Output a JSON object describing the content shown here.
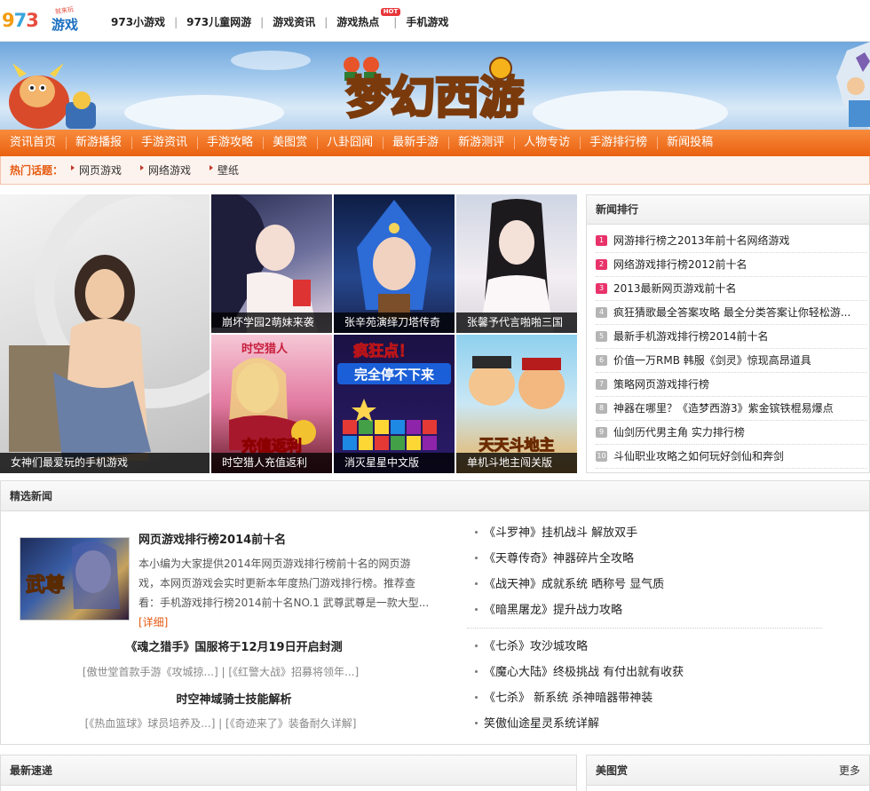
{
  "logo": {
    "digits": [
      "9",
      "7",
      "3"
    ],
    "name": "游戏",
    "slogan": "就来玩"
  },
  "topnav": {
    "items": [
      "973小游戏",
      "973儿童网游",
      "游戏资讯",
      "游戏热点",
      "手机游戏"
    ],
    "hot_badge": "HOT",
    "separator": "|"
  },
  "banner": {
    "title_art": "梦幻西游"
  },
  "mainnav": [
    "资讯首页",
    "新游播报",
    "手游资讯",
    "手游攻略",
    "美图赏",
    "八卦囧闻",
    "最新手游",
    "新游测评",
    "人物专访",
    "手游排行榜",
    "新闻投稿"
  ],
  "hot_topics": {
    "label": "热门话题：",
    "tags": [
      "网页游戏",
      "网络游戏",
      "壁纸"
    ]
  },
  "tiles": [
    {
      "caption": "女神们最爱玩的手机游戏"
    },
    {
      "caption": "崩坏学园2萌妹来袭"
    },
    {
      "caption": "张辛苑演绎刀塔传奇"
    },
    {
      "caption": "张馨予代言啪啪三国"
    },
    {
      "caption": "时空猎人充值返利"
    },
    {
      "caption": "消灭星星中文版"
    },
    {
      "caption": "单机斗地主闯关版"
    }
  ],
  "tile_art": {
    "t4_top": "时空猎人",
    "t4_bottom": "充值返利",
    "t5_top": "疯狂点！",
    "t5_bottom": "完全停不下来",
    "t6_text": "天天斗地主"
  },
  "ranking": {
    "title": "新闻排行",
    "items": [
      {
        "num": "1",
        "text": "网游排行榜之2013年前十名网络游戏"
      },
      {
        "num": "2",
        "text": "网络游戏排行榜2012前十名"
      },
      {
        "num": "3",
        "text": "2013最新网页游戏前十名"
      },
      {
        "num": "4",
        "text": "疯狂猜歌最全答案攻略 最全分类答案让你轻松游..."
      },
      {
        "num": "5",
        "text": "最新手机游戏排行榜2014前十名"
      },
      {
        "num": "6",
        "text": "价值一万RMB 韩服《剑灵》惊现高昂道具"
      },
      {
        "num": "7",
        "text": "策略网页游戏排行榜"
      },
      {
        "num": "8",
        "text": "神器在哪里？《造梦西游3》紫金镔铁棍易爆点"
      },
      {
        "num": "9",
        "text": "仙剑历代男主角 实力排行榜"
      },
      {
        "num": "10",
        "text": "斗仙职业攻略之如何玩好剑仙和奔剑"
      }
    ]
  },
  "selected": {
    "title": "精选新闻",
    "featured": {
      "title": "网页游戏排行榜2014前十名",
      "desc": "本小编为大家提供2014年网页游戏排行榜前十名的网页游戏，本网页游戏会实时更新本年度热门游戏排行榜。推荐查看：手机游戏排行榜2014前十名NO.1 武尊武尊是一款大型...",
      "more": "[详细]",
      "img_text": "武尊"
    },
    "sub": [
      {
        "title": "《魂之猎手》国服将于12月19日开启封测",
        "links": "[傲世堂首款手游《攻城掠...] | [《红警大战》招募将领年...]"
      },
      {
        "title": "时空神域骑士技能解析",
        "links": "[《热血篮球》球员培养及...] | [《奇迹来了》装备耐久详解]"
      }
    ],
    "right_group1": [
      "《斗罗神》挂机战斗 解放双手",
      "《天尊传奇》神器碎片全攻略",
      "《战天神》成就系统 晒称号 显气质",
      "《暗黑屠龙》提升战力攻略"
    ],
    "right_group2": [
      "《七杀》攻沙城攻略",
      "《魔心大陆》终极挑战 有付出就有收获",
      "《七杀》 新系统 杀神暗器带神装",
      "笑傲仙途星灵系统详解"
    ]
  },
  "latest": {
    "title": "最新速递"
  },
  "gallery": {
    "title": "美图赏",
    "more": "更多"
  },
  "colors": {
    "accent": "#e96210",
    "nav_bg": "#f07a26",
    "hot_label": "#e65a10",
    "rank_top": "#e8336a"
  }
}
